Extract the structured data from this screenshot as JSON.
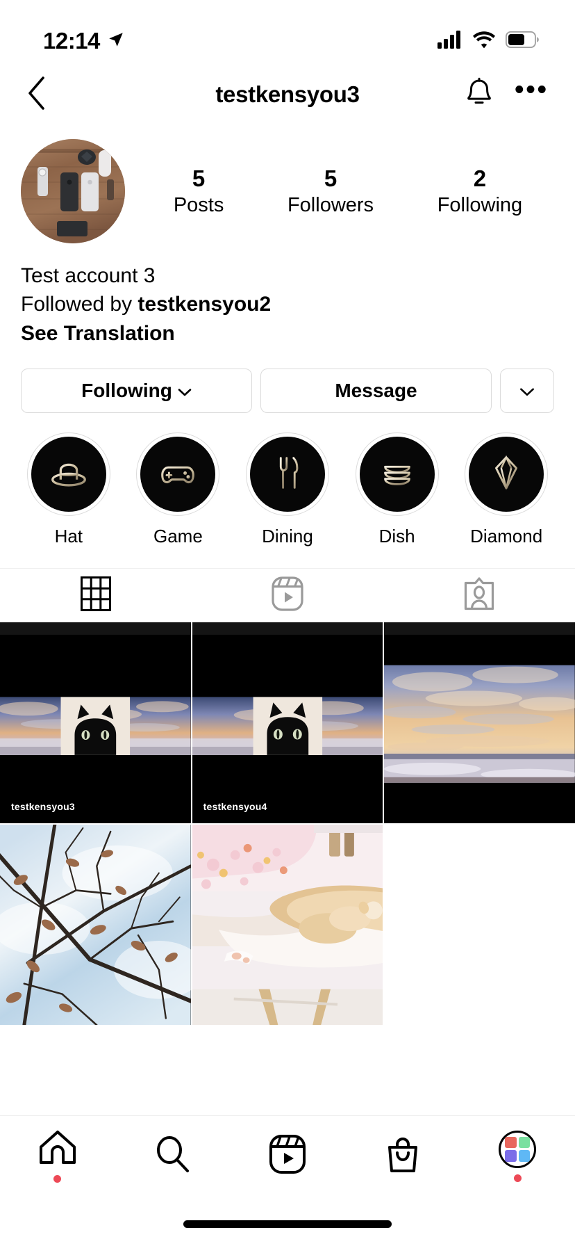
{
  "status_bar": {
    "time": "12:14",
    "location_icon": "location-arrow-icon",
    "cellular_icon": "cellular-signal-icon",
    "wifi_icon": "wifi-icon",
    "battery_icon": "battery-icon"
  },
  "nav": {
    "back_icon": "back-chevron-icon",
    "title": "testkensyou3",
    "bell_icon": "bell-icon",
    "more_icon": "ellipsis-icon",
    "more_label": "•••"
  },
  "profile": {
    "avatar_alt": "profile-photo-phones-on-desk",
    "stats": [
      {
        "num": "5",
        "label": "Posts"
      },
      {
        "num": "5",
        "label": "Followers"
      },
      {
        "num": "2",
        "label": "Following"
      }
    ],
    "bio_name": "Test account 3",
    "followed_by_prefix": "Followed by ",
    "followed_by_user": "testkensyou2",
    "see_translation": "See Translation"
  },
  "actions": {
    "following_label": "Following",
    "following_chevron": "chevron-down-icon",
    "message_label": "Message",
    "more_chevron": "chevron-down-icon"
  },
  "highlights": [
    {
      "label": "Hat",
      "icon": "hat-icon"
    },
    {
      "label": "Game",
      "icon": "game-controller-icon"
    },
    {
      "label": "Dining",
      "icon": "fork-knife-icon"
    },
    {
      "label": "Dish",
      "icon": "stacked-dishes-icon"
    },
    {
      "label": "Diamond",
      "icon": "diamond-icon"
    }
  ],
  "tabs": [
    {
      "name": "grid",
      "icon": "grid-icon",
      "active": true
    },
    {
      "name": "reels",
      "icon": "reels-icon",
      "active": false
    },
    {
      "name": "tagged",
      "icon": "tagged-icon",
      "active": false
    }
  ],
  "posts": [
    {
      "type": "reel",
      "badge": "reels-icon",
      "watermark": "testkensyou3",
      "scene": "sunset-ocean-with-cat"
    },
    {
      "type": "reel",
      "badge": "reels-icon",
      "watermark": "testkensyou4",
      "scene": "cat-with-sunset-ocean"
    },
    {
      "type": "reel",
      "badge": "reels-icon",
      "watermark": "",
      "scene": "sunset-ocean"
    },
    {
      "type": "photo",
      "badge": "",
      "watermark": "",
      "scene": "bare-branches-sky"
    },
    {
      "type": "photo",
      "badge": "",
      "watermark": "",
      "scene": "ginger-cat-on-white-table"
    }
  ],
  "bottom_nav": [
    {
      "name": "home",
      "icon": "home-icon",
      "badge": true
    },
    {
      "name": "search",
      "icon": "search-icon",
      "badge": false
    },
    {
      "name": "reels",
      "icon": "reels-icon",
      "badge": false
    },
    {
      "name": "shop",
      "icon": "shop-bag-icon",
      "badge": false
    },
    {
      "name": "profile",
      "icon": "profile-avatar-icon",
      "badge": true
    }
  ],
  "colors": {
    "accent_red": "#ED4956",
    "border": "#dbdbdb",
    "divider": "#efefef",
    "highlight_bg": "#070707",
    "highlight_gold": "#d9cdb4",
    "avatar_q1": "#e8685e",
    "avatar_q2": "#7ae0a0",
    "avatar_q3": "#7b6de8",
    "avatar_q4": "#5fb8f5"
  }
}
